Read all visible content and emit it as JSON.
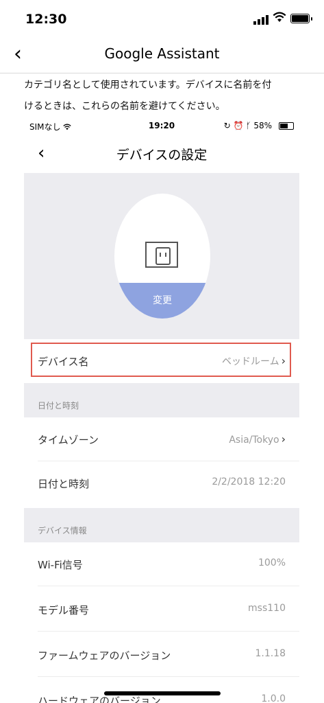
{
  "status_bar": {
    "time": "12:30"
  },
  "nav": {
    "title": "Google Assistant"
  },
  "paragraph": {
    "line1": "カテゴリ名として使用されています。デバイスに名前を付",
    "line2": "けるときは、これらの名前を避けてください。"
  },
  "screenshot": {
    "status": {
      "carrier": "SIMなし",
      "time": "19:20",
      "battery": "58%"
    },
    "title": "デバイスの設定",
    "change_button": "変更",
    "device_name": {
      "label": "デバイス名",
      "value": "ベッドルーム"
    },
    "section_datetime": "日付と時刻",
    "timezone": {
      "label": "タイムゾーン",
      "value": "Asia/Tokyo"
    },
    "datetime": {
      "label": "日付と時刻",
      "value": "2/2/2018 12:20"
    },
    "section_info": "デバイス情報",
    "wifi": {
      "label": "Wi-Fi信号",
      "value": "100%"
    },
    "model": {
      "label": "モデル番号",
      "value": "mss110"
    },
    "firmware": {
      "label": "ファームウェアのバージョン",
      "value": "1.1.18"
    },
    "hardware": {
      "label": "ハードウェアのバージョン",
      "value": "1.0.0"
    }
  },
  "colors": {
    "accent": "#8ea3e0",
    "highlight": "#e05a4e",
    "section_bg": "#ececf0"
  }
}
